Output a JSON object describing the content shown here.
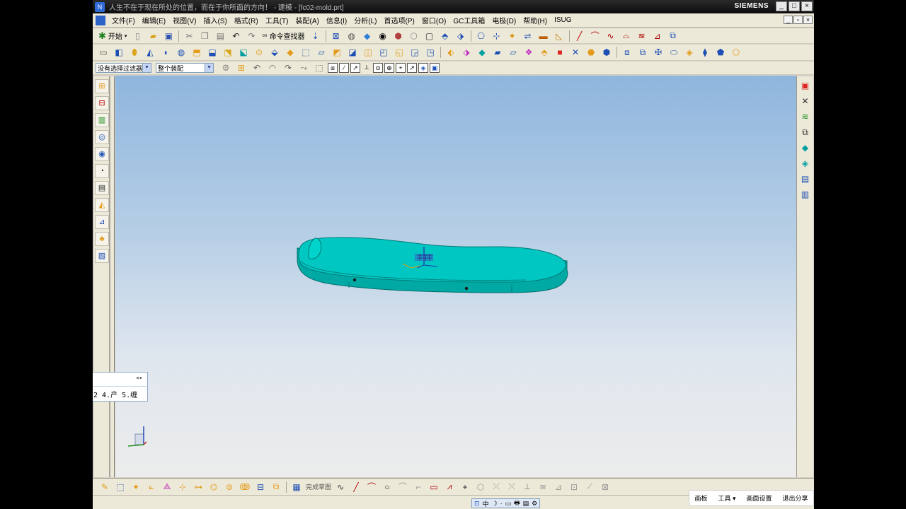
{
  "window": {
    "title": "人生不在于现在所处的位置，而在于你所面的方向！ - 建模 - [fc02-mold.prt]",
    "brand": "SIEMENS",
    "controls": [
      "_",
      "□",
      "×"
    ]
  },
  "menubar": {
    "items": [
      "文件(F)",
      "编辑(E)",
      "视图(V)",
      "插入(S)",
      "格式(R)",
      "工具(T)",
      "装配(A)",
      "信息(I)",
      "分析(L)",
      "首选项(P)",
      "窗口(O)",
      "GC工具箱",
      "电极(D)",
      "帮助(H)",
      "ISUG"
    ],
    "mdi_controls": [
      "_",
      "▫",
      "×"
    ]
  },
  "toolbar1": {
    "start_label": "开始",
    "command_finder_label": "命令查找器"
  },
  "toolbar3": {
    "filter_value": "没有选择过滤器",
    "scope_value": "整个装配"
  },
  "popup": {
    "nav": "◂▸",
    "text": "2 4.产 5.缠"
  },
  "bottom_toolbar": {
    "sketch_label": "完成草图"
  },
  "ime_bar": {
    "items": [
      "中",
      "☽",
      "·",
      "▭",
      "🖶",
      "▤",
      "⚙"
    ]
  },
  "floating_bar": {
    "items": [
      "画板",
      "工具 ▾",
      "画面设置",
      "退出分享"
    ]
  },
  "colors": {
    "part": "#00c7c2",
    "part_dark": "#00a9a4",
    "part_edge": "#006f6c",
    "title_bg": "#111111",
    "menu_bg": "#ece9d8"
  }
}
